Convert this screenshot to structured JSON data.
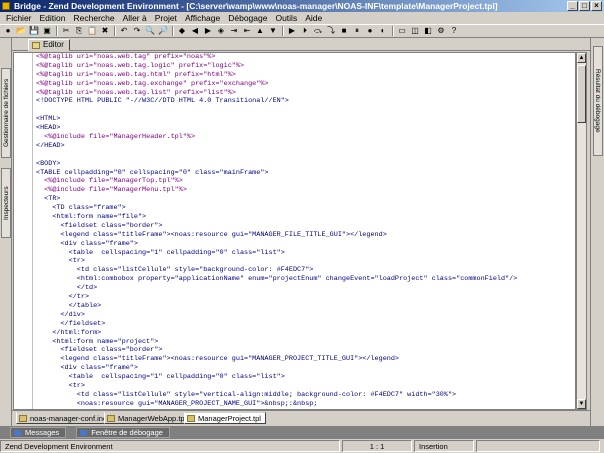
{
  "window": {
    "title": "Bridge - Zend Development Environment - [C:\\server\\wamp\\www\\noas-manager\\NOAS-INF\\template\\ManagerProject.tpl]"
  },
  "menu": [
    "Fichier",
    "Edition",
    "Recherche",
    "Aller à",
    "Projet",
    "Affichage",
    "Débogage",
    "Outils",
    "Aide"
  ],
  "toolbar": {
    "icons": [
      "new-file-icon",
      "open-icon",
      "save-icon",
      "save-all-icon",
      "cut-icon",
      "copy-icon",
      "paste-icon",
      "delete-icon",
      "undo-icon",
      "redo-icon",
      "find-icon",
      "find-next-icon",
      "bookmark-icon",
      "prev-bookmark-icon",
      "next-bookmark-icon",
      "toggle-bookmark-icon",
      "indent-icon",
      "outdent-icon",
      "go-up-icon",
      "go-down-icon",
      "run-icon",
      "debug-icon",
      "step-icon",
      "step-into-icon",
      "stop-icon",
      "pause-icon",
      "breakpoint-icon",
      "profile-icon",
      "window-icon",
      "cascade-icon",
      "tile-icon",
      "tool-icon",
      "help-icon"
    ],
    "glyphs": [
      "●",
      "📂",
      "💾",
      "▣",
      "✂",
      "⎘",
      "📋",
      "✖",
      "↶",
      "↷",
      "🔍",
      "🔎",
      "◆",
      "◀",
      "▶",
      "◈",
      "⇥",
      "⇤",
      "▲",
      "▼",
      "▶",
      "⏵",
      "⤼",
      "⤵",
      "■",
      "⏸",
      "●",
      "◐",
      "▭",
      "◫",
      "◧",
      "⚙",
      "?"
    ]
  },
  "left_panels": [
    {
      "label": "Gestionnaire de fichiers"
    },
    {
      "label": "Inspecteurs"
    }
  ],
  "right_panel": {
    "label": "Résultat du débogage"
  },
  "editor_tab": {
    "label": "Editor"
  },
  "editor": {
    "lines": [
      {
        "n": "1",
        "t": "<%@taglib uri=\"noas.web.tag\" prefix=\"noas\"%>"
      },
      {
        "n": "2",
        "t": "<%@taglib uri=\"noas.web.tag.logic\" prefix=\"logic\"%>"
      },
      {
        "n": "3",
        "t": "<%@taglib uri=\"noas.web.tag.html\" prefix=\"html\"%>"
      },
      {
        "n": "4",
        "t": "<%@taglib uri=\"noas.web.tag.exchange\" prefix=\"exchange\"%>"
      },
      {
        "n": "5",
        "t": "<%@taglib uri=\"noas.web.tag.list\" prefix=\"list\"%>"
      },
      {
        "n": "6",
        "t": "<!DOCTYPE HTML PUBLIC \"-//W3C//DTD HTML 4.0 Transitional//EN\">"
      },
      {
        "n": "7",
        "t": ""
      },
      {
        "n": "8",
        "t": "<HTML>"
      },
      {
        "n": "9",
        "t": "<HEAD>"
      },
      {
        "n": "10",
        "t": "  <%@include file=\"ManagerHeader.tpl\"%>"
      },
      {
        "n": "11",
        "t": "</HEAD>"
      },
      {
        "n": "12",
        "t": ""
      },
      {
        "n": "13",
        "t": "<BODY>"
      },
      {
        "n": "14",
        "t": "<TABLE cellpadding=\"0\" cellspacing=\"0\" class=\"mainFrame\">"
      },
      {
        "n": "15",
        "t": "  <%@include file=\"ManagerTop.tpl\"%>"
      },
      {
        "n": "16",
        "t": "  <%@include file=\"ManagerMenu.tpl\"%>"
      },
      {
        "n": "17",
        "t": "  <TR>"
      },
      {
        "n": "18",
        "t": "    <TD class=\"frame\">"
      },
      {
        "n": "19",
        "t": "    <html:form name=\"file\">"
      },
      {
        "n": "20",
        "t": "      <fieldset class=\"border\">"
      },
      {
        "n": "21",
        "t": "      <legend class=\"titleFrame\"><noas:resource gui=\"MANAGER_FILE_TITLE_GUI\"></legend>"
      },
      {
        "n": "22",
        "t": "      <div class=\"frame\">"
      },
      {
        "n": "23",
        "t": "        <table  cellspacing=\"1\" cellpadding=\"0\" class=\"list\">"
      },
      {
        "n": "24",
        "t": "        <tr>"
      },
      {
        "n": "25",
        "t": "          <td class=\"listCellule\" style=\"background-color: #F4EDC7\">"
      },
      {
        "n": "26",
        "t": "          <html:combobox property=\"applicationName\" enum=\"projectEnum\" changeEvent=\"loadProject\" class=\"commonField\"/>"
      },
      {
        "n": "27",
        "t": "          </td>"
      },
      {
        "n": "28",
        "t": "        </tr>"
      },
      {
        "n": "29",
        "t": "        </table>"
      },
      {
        "n": "30",
        "t": "      </div>"
      },
      {
        "n": "31",
        "t": "      </fieldset>"
      },
      {
        "n": "32",
        "t": "    </html:form>"
      },
      {
        "n": "33",
        "t": "    <html:form name=\"project\">"
      },
      {
        "n": "34",
        "t": "      <fieldset class=\"border\">"
      },
      {
        "n": "35",
        "t": "      <legend class=\"titleFrame\"><noas:resource gui=\"MANAGER_PROJECT_TITLE_GUI\"></legend>"
      },
      {
        "n": "36",
        "t": "      <div class=\"frame\">"
      },
      {
        "n": "37",
        "t": "        <table  cellspacing=\"1\" cellpadding=\"0\" class=\"list\">"
      },
      {
        "n": "38",
        "t": "        <tr>"
      },
      {
        "n": "39",
        "t": "          <td class=\"listCellule\" style=\"vertical-align:middle; background-color: #F4EDC7\" width=\"30%\">"
      },
      {
        "n": "40",
        "t": "          <noas:resource gui=\"MANAGER_PROJECT_NAME_GUI\">&nbsp;:&nbsp;"
      },
      {
        "n": "41",
        "t": "          </td>"
      },
      {
        "n": "42",
        "t": "          <td class=\"listCellule\" style=\"background-color: #F4EDC7\">"
      }
    ]
  },
  "file_tabs": [
    "noas-manager-conf.inc",
    "ManagerWebApp.tpl",
    "ManagerProject.tpl"
  ],
  "bottom_tabs": [
    "Messages",
    "Fenêtre de débogage"
  ],
  "status": {
    "mode": "Zend Development Environment",
    "position": "1 : 1",
    "insert": "Insertion"
  }
}
